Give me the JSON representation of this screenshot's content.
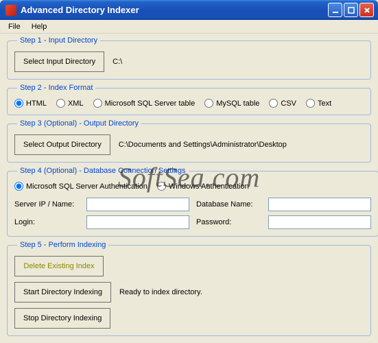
{
  "window": {
    "title": "Advanced Directory Indexer"
  },
  "menu": {
    "file": "File",
    "help": "Help"
  },
  "step1": {
    "legend": "Step 1 - Input Directory",
    "button": "Select Input Directory",
    "path": "C:\\"
  },
  "step2": {
    "legend": "Step 2 - Index Format",
    "options": {
      "html": "HTML",
      "xml": "XML",
      "mssql": "Microsoft SQL Server table",
      "mysql": "MySQL table",
      "csv": "CSV",
      "text": "Text"
    },
    "selected": "html"
  },
  "step3": {
    "legend": "Step 3 (Optional) - Output Directory",
    "button": "Select Output Directory",
    "path": "C:\\Documents and Settings\\Administrator\\Desktop"
  },
  "step4": {
    "legend": "Step 4 (Optional) - Database Connection Settings",
    "auth_sql": "Microsoft SQL Server Authentication",
    "auth_win": "Windows Authentication",
    "server_label": "Server IP / Name:",
    "server_value": "",
    "db_label": "Database Name:",
    "db_value": "",
    "login_label": "Login:",
    "login_value": "",
    "password_label": "Password:",
    "password_value": ""
  },
  "step5": {
    "legend": "Step 5 - Perform Indexing",
    "delete_btn": "Delete Existing Index",
    "start_btn": "Start Directory Indexing",
    "stop_btn": "Stop Directory Indexing",
    "status": "Ready to index directory."
  },
  "watermark": "SoftSea.com"
}
